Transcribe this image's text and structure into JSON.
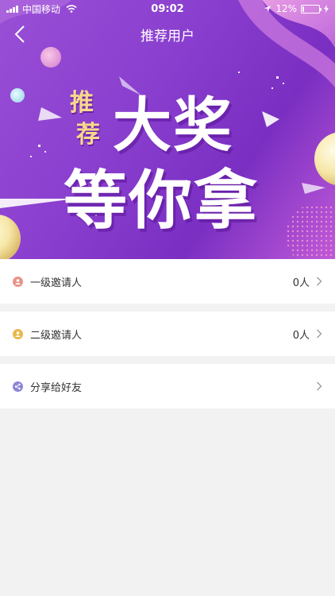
{
  "status_bar": {
    "carrier": "中国移动",
    "time": "09:02",
    "battery_percent": "12%",
    "battery_level": 0.12
  },
  "nav": {
    "title": "推荐用户",
    "back_icon": "chevron-left-icon"
  },
  "banner": {
    "badge_line1": "推",
    "badge_line2": "荐",
    "headline_line1": "大奖",
    "headline_line2": "等你拿"
  },
  "list": [
    {
      "label": "一级邀请人",
      "count": "0人",
      "icon": "user-icon",
      "icon_color": "#e8938a"
    },
    {
      "label": "二级邀请人",
      "count": "0人",
      "icon": "user-icon",
      "icon_color": "#e8b84a"
    },
    {
      "label": "分享给好友",
      "count": "",
      "icon": "share-icon",
      "icon_color": "#8c85d8"
    }
  ],
  "colors": {
    "banner_purple": "#8a3fcf",
    "page_background": "#f2f2f2",
    "badge_gold": "#f7d98c"
  }
}
